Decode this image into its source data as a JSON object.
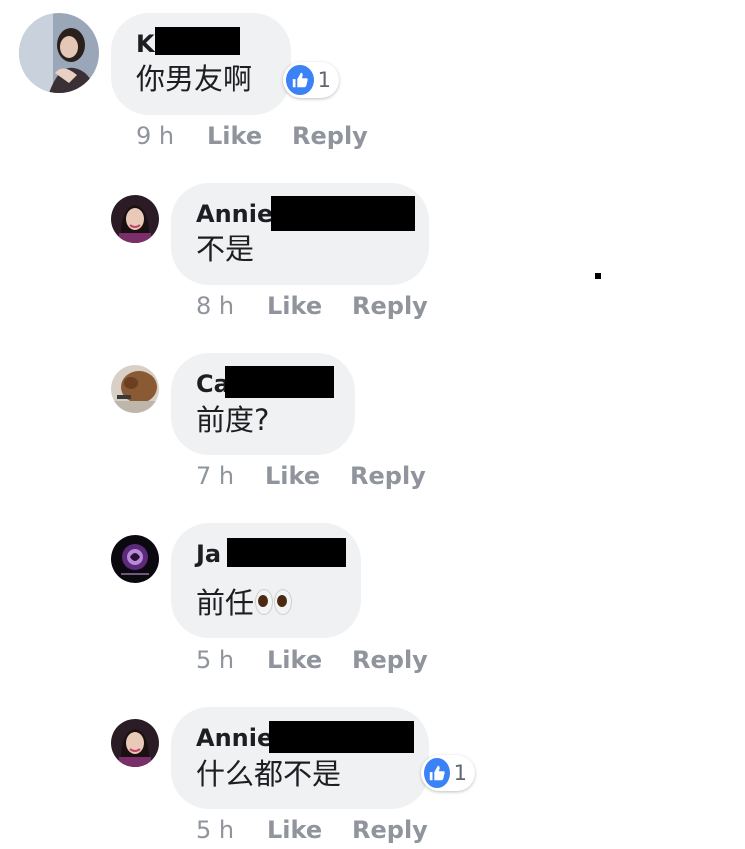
{
  "colors": {
    "bubble": "#f0f1f3",
    "meta": "#90949c",
    "like_blue": "#3b82f6"
  },
  "comments": [
    {
      "name": "K",
      "text": "你男友啊",
      "time": "9 h",
      "like": "Like",
      "reply": "Reply",
      "reactions": "1",
      "reaction_icon": "thumbs-up-icon"
    },
    {
      "name": "Annie",
      "text": "不是",
      "time": "8 h",
      "like": "Like",
      "reply": "Reply"
    },
    {
      "name": "Ca",
      "text": "前度?",
      "time": "7 h",
      "like": "Like",
      "reply": "Reply"
    },
    {
      "name": "Ja",
      "text": "前任",
      "time": "5 h",
      "like": "Like",
      "reply": "Reply",
      "emoji": "eyes-emoji"
    },
    {
      "name": "Annie",
      "text": "什么都不是",
      "time": "5 h",
      "like": "Like",
      "reply": "Reply",
      "reactions": "1",
      "reaction_icon": "thumbs-up-icon"
    }
  ]
}
